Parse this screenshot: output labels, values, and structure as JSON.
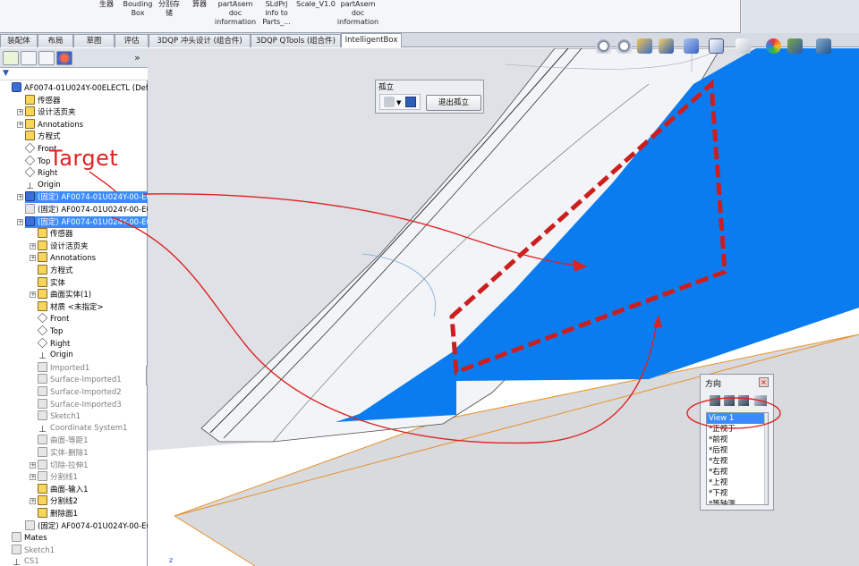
{
  "ribbon": {
    "buttons": [
      {
        "label": "生器"
      },
      {
        "label": "Bouding\nBox"
      },
      {
        "label": "分别存\n储"
      },
      {
        "label": "算器"
      },
      {
        "label": "partAsem\ndoc\ninformation"
      },
      {
        "label": "SLdPrj\ninfo to\nParts_..."
      },
      {
        "label": "Scale_V1.0"
      },
      {
        "label": "partAsem\ndoc\ninformation"
      }
    ]
  },
  "tabs": [
    {
      "label": "装配体"
    },
    {
      "label": "布局"
    },
    {
      "label": "草图"
    },
    {
      "label": "评估"
    },
    {
      "label": "3DQP 冲头设计 (组合件)"
    },
    {
      "label": "3DQP QTools (组合件)"
    },
    {
      "label": "IntelligentBox"
    }
  ],
  "tree": {
    "panel_collapse": "»",
    "filter_icon": "funnel-icon",
    "nodes": [
      {
        "label": "AF0074-01U024Y-00ELECTL  (Default"
      },
      {
        "label": "传感器"
      },
      {
        "label": "设计活页夹"
      },
      {
        "label": "Annotations"
      },
      {
        "label": "方程式"
      },
      {
        "label": "Front"
      },
      {
        "label": "Top"
      },
      {
        "label": "Right"
      },
      {
        "label": "Origin"
      },
      {
        "label": "(固定) AF0074-01U024Y-00-E01<1"
      },
      {
        "label": "(固定) AF0074-01U024Y-00-E01<1"
      },
      {
        "label": "(固定) AF0074-01U024Y-00-E02<1"
      },
      {
        "label": "传感器"
      },
      {
        "label": "设计活页夹"
      },
      {
        "label": "Annotations"
      },
      {
        "label": "方程式"
      },
      {
        "label": "实体"
      },
      {
        "label": "曲面实体(1)"
      },
      {
        "label": "材质 <未指定>"
      },
      {
        "label": "Front"
      },
      {
        "label": "Top"
      },
      {
        "label": "Right"
      },
      {
        "label": "Origin"
      },
      {
        "label": "Imported1"
      },
      {
        "label": "Surface-Imported1"
      },
      {
        "label": "Surface-Imported2"
      },
      {
        "label": "Surface-Imported3"
      },
      {
        "label": "Sketch1"
      },
      {
        "label": "Coordinate System1"
      },
      {
        "label": "曲面-等距1"
      },
      {
        "label": "实体-删除1"
      },
      {
        "label": "切除-拉伸1"
      },
      {
        "label": "分割线1"
      },
      {
        "label": "曲面-输入1"
      },
      {
        "label": "分割线2"
      },
      {
        "label": "删除面1"
      },
      {
        "label": "(固定) AF0074-01U024Y-00-E03<1"
      },
      {
        "label": "Mates"
      },
      {
        "label": "Sketch1"
      },
      {
        "label": "CS1"
      }
    ]
  },
  "isolate": {
    "title": "孤立",
    "exit_label": "退出孤立"
  },
  "orientation": {
    "title": "方向",
    "close": "×",
    "items": [
      {
        "label": "View 1"
      },
      {
        "label": "*正视于"
      },
      {
        "label": "*前视"
      },
      {
        "label": "*后视"
      },
      {
        "label": "*左视"
      },
      {
        "label": "*右视"
      },
      {
        "label": "*上视"
      },
      {
        "label": "*下视"
      },
      {
        "label": "*等轴测"
      }
    ]
  },
  "annotation": {
    "target_label": "Target",
    "color": "#dd2222"
  },
  "colors": {
    "surface_blue": "#0a7cf0",
    "selection": "#3b8bff",
    "dash_red": "#cc1e1e"
  },
  "viewport": {
    "axis_label": "z"
  }
}
